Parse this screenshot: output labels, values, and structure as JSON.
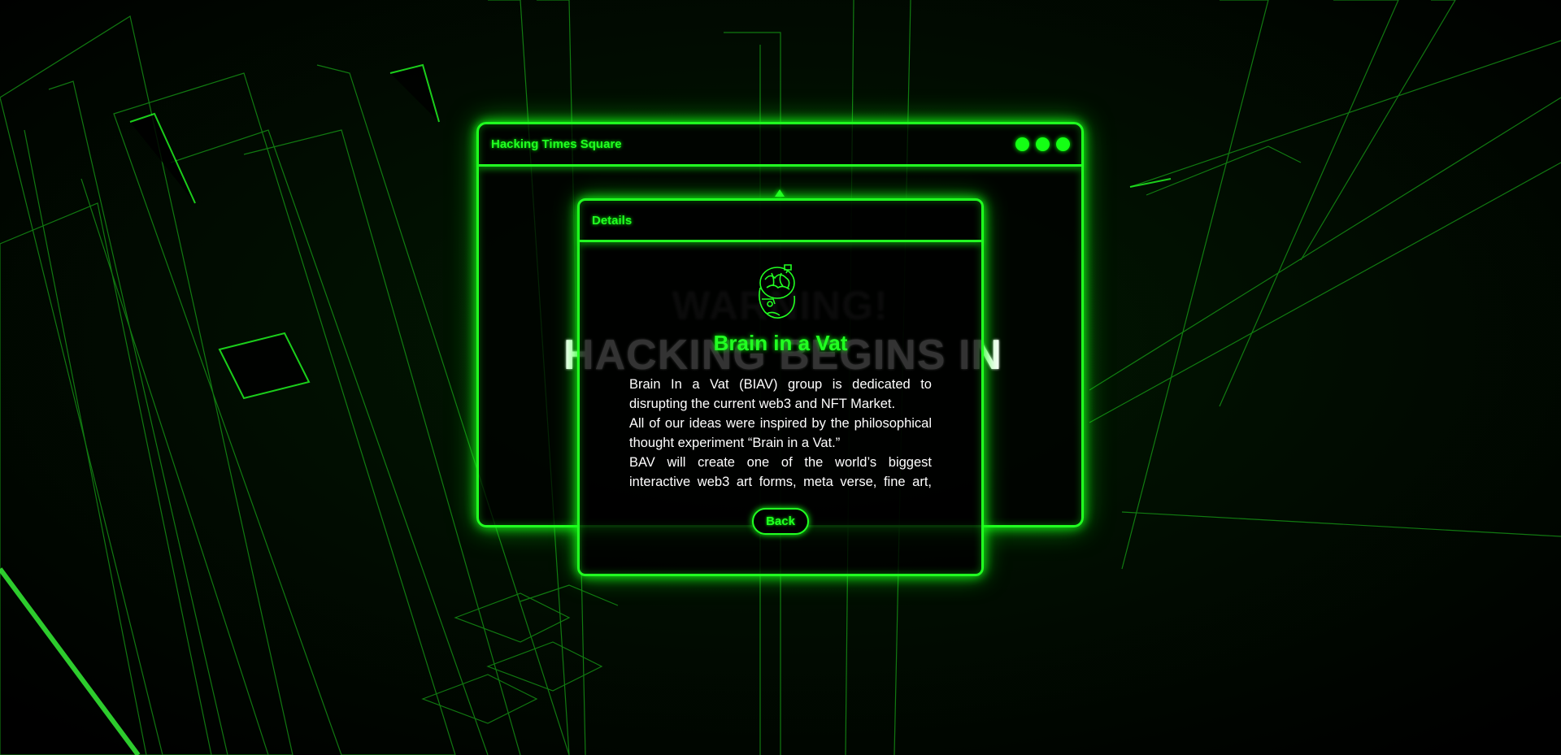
{
  "main_window": {
    "title": "Hacking Times Square",
    "window_controls": [
      "minimize-dot",
      "maximize-dot",
      "close-dot"
    ],
    "background_text": {
      "line1": "WARNING!",
      "line2": "HACKING BEGINS IN"
    }
  },
  "details_dialog": {
    "title": "Details",
    "avatar_icon": "brain-in-vat-icon",
    "heading": "Brain in a Vat",
    "paragraphs": [
      "Brain In a Vat (BIAV) group is dedicated to disrupting the current web3 and NFT Market.",
      "All of our ideas were inspired by the philosophical thought experiment “Brain in a Vat.”",
      "BAV will create one of the world’s biggest interactive web3 art forms, meta verse, fine art, and NFT."
    ],
    "back_label": "Back"
  },
  "colors": {
    "neon_green": "#22ff22",
    "background": "#000000",
    "text_white": "#ffffff"
  }
}
